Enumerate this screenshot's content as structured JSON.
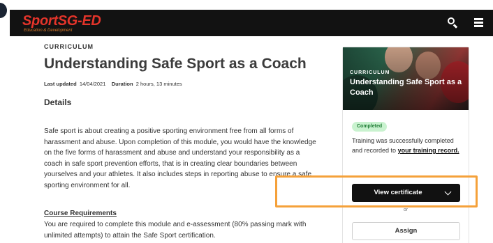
{
  "header": {
    "logo_main": "SportSG-",
    "logo_accent": "ED",
    "logo_sub": "Education & Development",
    "icons": [
      "search-icon",
      "menu-icon"
    ]
  },
  "course": {
    "eyebrow": "CURRICULUM",
    "title": "Understanding Safe Sport as a Coach",
    "last_updated_label": "Last updated",
    "last_updated_value": "14/04/2021",
    "duration_label": "Duration",
    "duration_value": "2 hours, 13 minutes",
    "details_heading": "Details",
    "description": "Safe sport is about creating a positive sporting environment free from all forms of harassment and abuse. Upon completion of this module, you would have the knowledge on the five forms of harassment and abuse and understand your responsibility as a coach in safe sport prevention efforts, that is in creating clear boundaries between yourselves and your athletes. It also includes steps in reporting abuse to ensure a safe sporting environment for all.",
    "requirements_heading": "Course Requirements",
    "requirements_text": "You are required to complete this module and e-assessment (80% passing mark with unlimited attempts) to attain the Safe Sport certification."
  },
  "sidebar_card": {
    "hero_eyebrow": "CURRICULUM",
    "hero_title": "Understanding Safe Sport as a Coach",
    "status_badge": "Completed",
    "status_text": "Training was successfully completed and recorded to",
    "status_link": "your training record.",
    "view_certificate_label": "View certificate",
    "or_label": "or",
    "assign_label": "Assign"
  },
  "colors": {
    "topbar": "#121212",
    "logo_red": "#e4342a",
    "badge_bg": "#c9f2cf",
    "badge_text": "#1e7b34",
    "highlight": "#f5a13a"
  }
}
